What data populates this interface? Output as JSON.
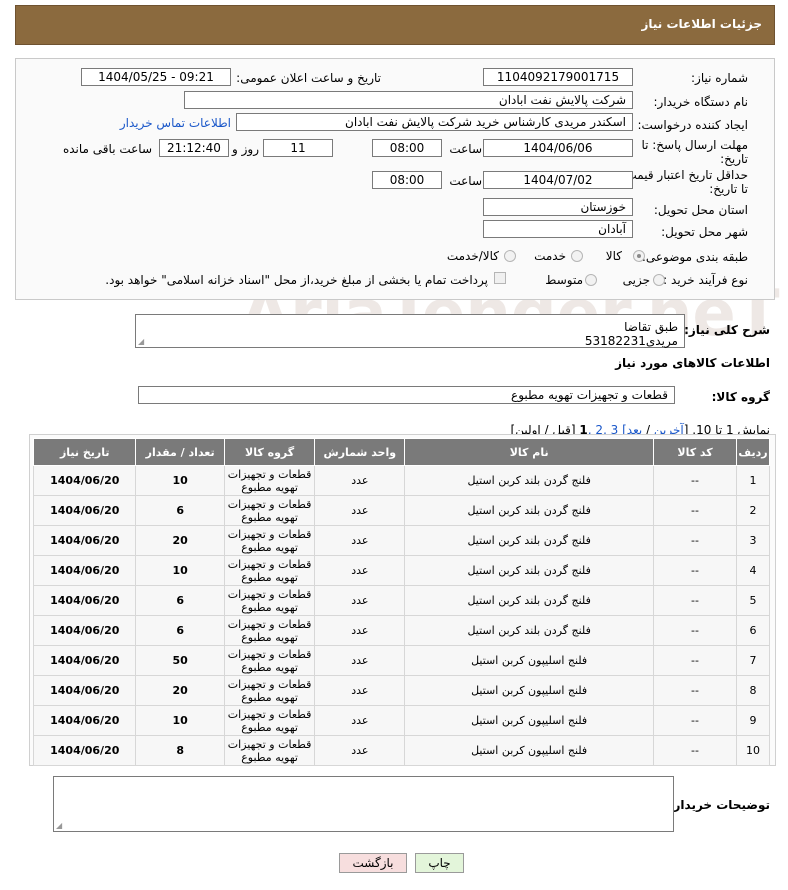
{
  "header": {
    "title": "جزئیات اطلاعات نیاز"
  },
  "watermark": "AriaTender.neT",
  "form": {
    "need_number_label": "شماره نیاز:",
    "need_number": "1104092179001715",
    "announce_label": "تاریخ و ساعت اعلان عمومی:",
    "announce_value": "1404/05/25 - 09:21",
    "buyer_org_label": "نام دستگاه خریدار:",
    "buyer_org": "شرکت پالایش نفت ابادان",
    "creator_label": "ایجاد کننده درخواست:",
    "creator": "اسکندر مریدی کارشناس خرید شرکت پالایش نفت ابادان",
    "buyer_contact_link": "اطلاعات تماس خریدار",
    "deadline_label_1": "مهلت ارسال پاسخ: تا",
    "deadline_label_2": "تاریخ:",
    "deadline_date": "1404/06/06",
    "time_label": "ساعت",
    "deadline_time": "08:00",
    "days_value": "11",
    "days_label": "روز و",
    "remaining_time": "21:12:40",
    "remaining_label": "ساعت باقی مانده",
    "price_validity_label_1": "حداقل تاریخ اعتبار قیمت:",
    "price_validity_label_2": "تا تاریخ:",
    "price_validity_date": "1404/07/02",
    "price_validity_time": "08:00",
    "province_label": "استان محل تحویل:",
    "province": "خوزستان",
    "city_label": "شهر محل تحویل:",
    "city": "آبادان",
    "category_label": "طبقه بندی موضوعی:",
    "category_options": [
      "کالا",
      "خدمت",
      "کالا/خدمت"
    ],
    "category_selected": "کالا",
    "process_label": "نوع فرآیند خرید :",
    "process_options": [
      "جزیی",
      "متوسط"
    ],
    "payment_note": "پرداخت تمام یا بخشی از مبلغ خرید،از محل \"اسناد خزانه اسلامی\" خواهد بود."
  },
  "description": {
    "label": "شرح کلی نیاز:",
    "text_line1": "طبق تقاضا",
    "text_line2": "مریدی53182231"
  },
  "goods_info_title": "اطلاعات کالاهای مورد نیاز",
  "goods_group": {
    "label": "گروه کالا:",
    "value": "قطعات و تجهیزات تهویه مطبوع"
  },
  "pagination": {
    "text_prefix": "نمایش 1 تا 10. [",
    "last": "آخرین",
    "sep1": " / ",
    "next": "بعد",
    "pages_links": "] 3 ,2 ,",
    "current": "1",
    "text_suffix": " [قبل / اولین]"
  },
  "table": {
    "headers": [
      "ردیف",
      "کد کالا",
      "نام کالا",
      "واحد شمارش",
      "گروه کالا",
      "تعداد / مقدار",
      "تاریخ نیاز"
    ],
    "rows": [
      [
        "1",
        "--",
        "فلنج گردن بلند کربن استیل",
        "عدد",
        "قطعات و تجهیزات تهویه مطبوع",
        "10",
        "1404/06/20"
      ],
      [
        "2",
        "--",
        "فلنج گردن بلند کربن استیل",
        "عدد",
        "قطعات و تجهیزات تهویه مطبوع",
        "6",
        "1404/06/20"
      ],
      [
        "3",
        "--",
        "فلنج گردن بلند کربن استیل",
        "عدد",
        "قطعات و تجهیزات تهویه مطبوع",
        "20",
        "1404/06/20"
      ],
      [
        "4",
        "--",
        "فلنج گردن بلند کربن استیل",
        "عدد",
        "قطعات و تجهیزات تهویه مطبوع",
        "10",
        "1404/06/20"
      ],
      [
        "5",
        "--",
        "فلنج گردن بلند کربن استیل",
        "عدد",
        "قطعات و تجهیزات تهویه مطبوع",
        "6",
        "1404/06/20"
      ],
      [
        "6",
        "--",
        "فلنج گردن بلند کربن استیل",
        "عدد",
        "قطعات و تجهیزات تهویه مطبوع",
        "6",
        "1404/06/20"
      ],
      [
        "7",
        "--",
        "فلنج اسلیپون کربن استیل",
        "عدد",
        "قطعات و تجهیزات تهویه مطبوع",
        "50",
        "1404/06/20"
      ],
      [
        "8",
        "--",
        "فلنج اسلیپون کربن استیل",
        "عدد",
        "قطعات و تجهیزات تهویه مطبوع",
        "20",
        "1404/06/20"
      ],
      [
        "9",
        "--",
        "فلنج اسلیپون کربن استیل",
        "عدد",
        "قطعات و تجهیزات تهویه مطبوع",
        "10",
        "1404/06/20"
      ],
      [
        "10",
        "--",
        "فلنج اسلیپون کربن استیل",
        "عدد",
        "قطعات و تجهیزات تهویه مطبوع",
        "8",
        "1404/06/20"
      ]
    ]
  },
  "buyer_notes": {
    "label": "توضیحات خریدار:"
  },
  "buttons": {
    "print": "چاپ",
    "back": "بازگشت"
  },
  "colors": {
    "header_bg": "#8b6a3e",
    "link": "#1a57c9",
    "table_header_bg": "#7a7a7a",
    "back_button_bg": "#f7dede",
    "print_button_bg": "#e3f5da"
  }
}
